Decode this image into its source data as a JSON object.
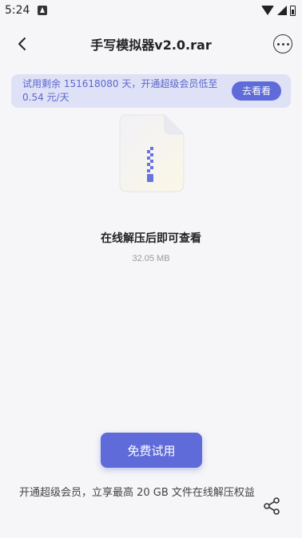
{
  "status_bar": {
    "time": "5:24",
    "notification_icon": "a-letter-icon",
    "icons": [
      "wifi-icon",
      "signal-icon",
      "battery-icon"
    ]
  },
  "header": {
    "title": "手写模拟器v2.0.rar",
    "back_icon": "chevron-left-icon",
    "more_icon": "more-icon"
  },
  "banner": {
    "text": "试用剩余 151618080 天，开通超级会员低至 0.54 元/天",
    "button_label": "去看看"
  },
  "file": {
    "icon": "zip-file-icon",
    "message": "在线解压后即可查看",
    "size": "32.05 MB"
  },
  "actions": {
    "trial_label": "免费试用",
    "promo_text": "开通超级会员，立享最高 20 GB 文件在线解压权益",
    "share_icon": "share-icon"
  },
  "colors": {
    "accent": "#5e6bd8",
    "banner_bg": "#dfe2f7",
    "banner_text": "#5d67c9",
    "page_bg": "#f6f6f8"
  }
}
